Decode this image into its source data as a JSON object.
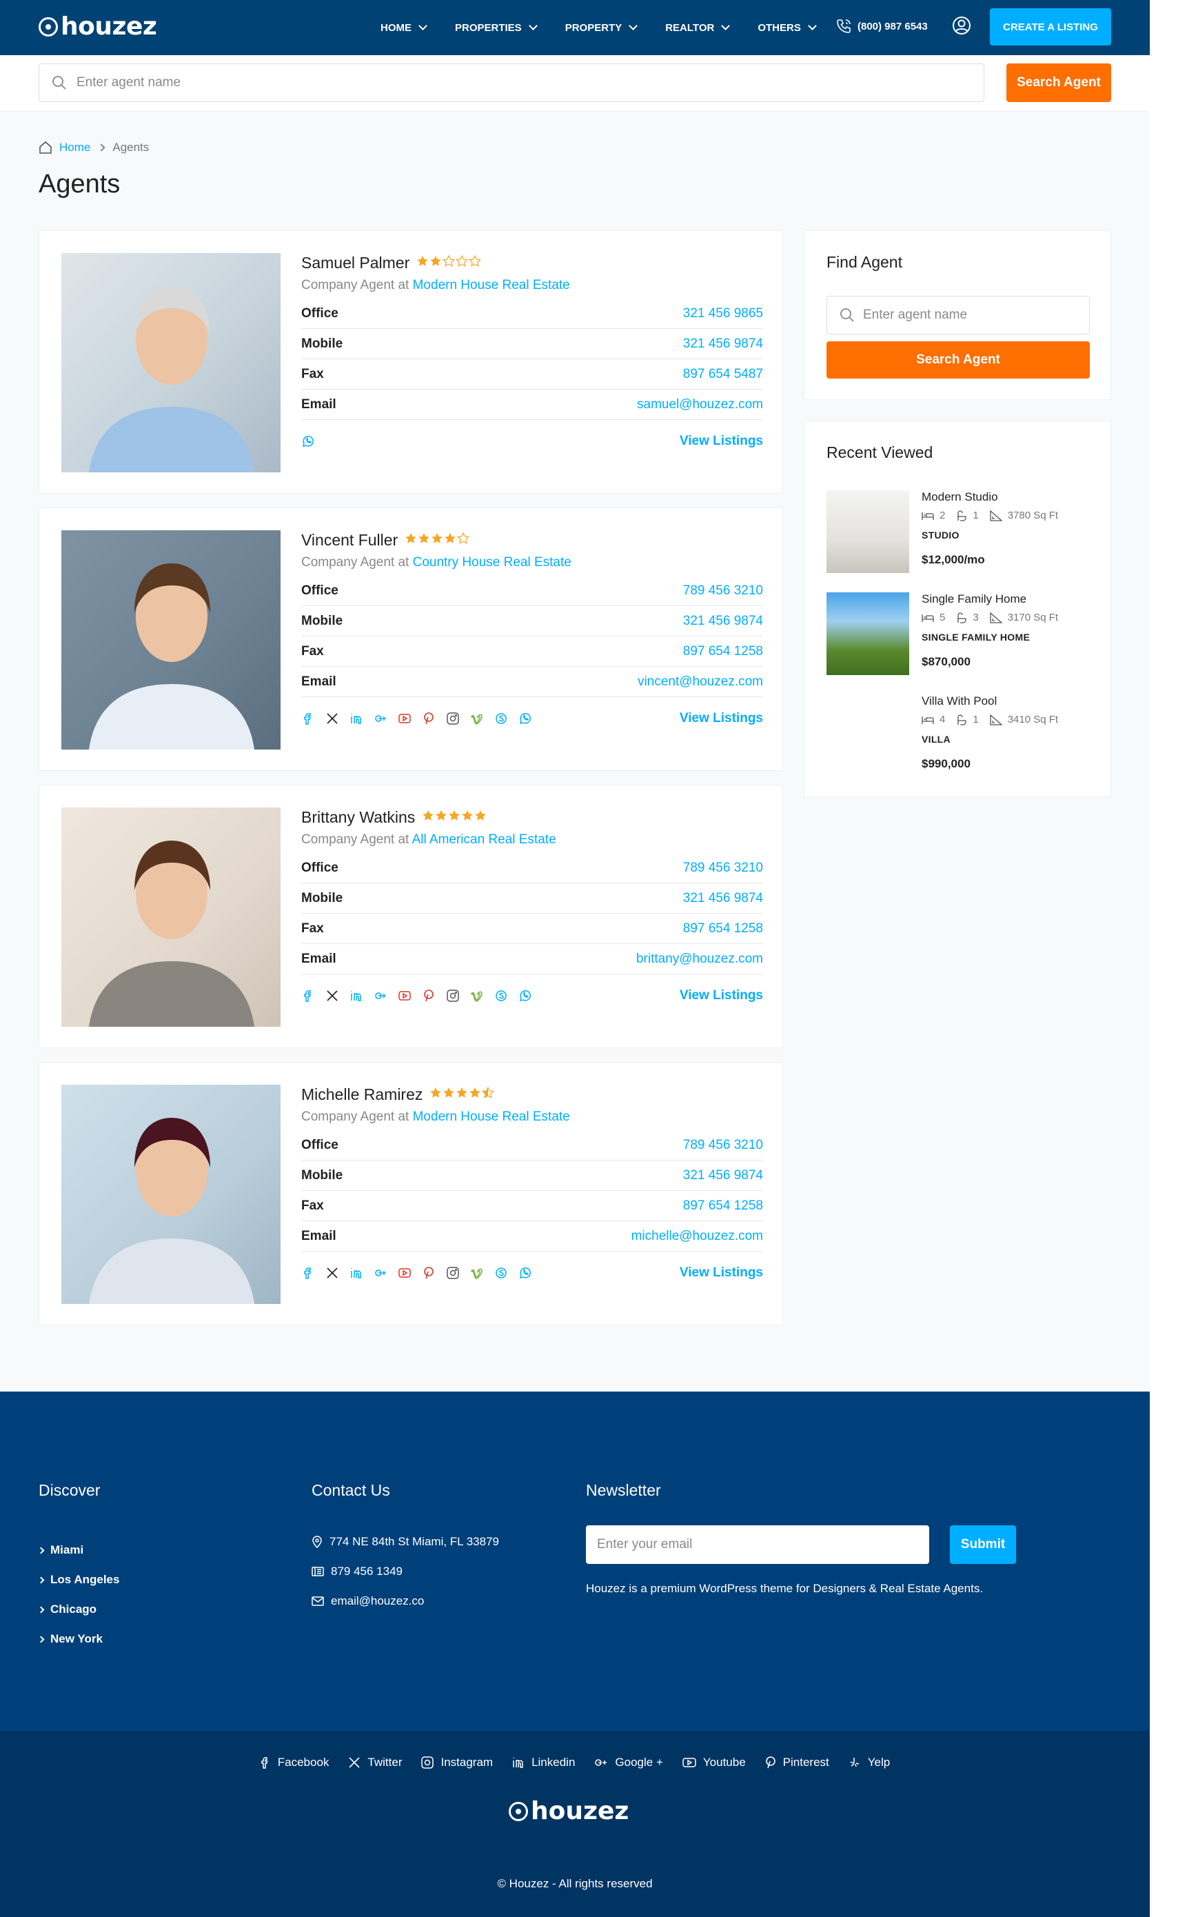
{
  "header": {
    "logo": "houzez",
    "nav": [
      "HOME",
      "PROPERTIES",
      "PROPERTY",
      "REALTOR",
      "OTHERS"
    ],
    "phone": "(800) 987 6543",
    "create_listing": "CREATE A LISTING"
  },
  "top_search": {
    "placeholder": "Enter agent name",
    "button": "Search Agent"
  },
  "breadcrumb": {
    "home": "Home",
    "current": "Agents"
  },
  "page_title": "Agents",
  "labels": {
    "office": "Office",
    "mobile": "Mobile",
    "fax": "Fax",
    "email": "Email",
    "company_prefix": "Company Agent at",
    "view_listings": "View Listings"
  },
  "agents": [
    {
      "name": "Samuel Palmer",
      "rating": 2,
      "company": "Modern House Real Estate",
      "office": "321 456 9865",
      "mobile": "321 456 9874",
      "fax": "897 654 5487",
      "email": "samuel@houzez.com",
      "social_icons": [
        "whatsapp-icon"
      ]
    },
    {
      "name": "Vincent Fuller",
      "rating": 4,
      "company": "Country House Real Estate",
      "office": "789 456 3210",
      "mobile": "321 456 9874",
      "fax": "897 654 1258",
      "email": "vincent@houzez.com",
      "social_icons": [
        "facebook-icon",
        "x-icon",
        "linkedin-icon",
        "google-plus-icon",
        "youtube-icon",
        "pinterest-icon",
        "instagram-icon",
        "vimeo-icon",
        "skype-icon",
        "whatsapp-icon"
      ]
    },
    {
      "name": "Brittany Watkins",
      "rating": 5,
      "company": "All American Real Estate",
      "office": "789 456 3210",
      "mobile": "321 456 9874",
      "fax": "897 654 1258",
      "email": "brittany@houzez.com",
      "social_icons": [
        "facebook-icon",
        "x-icon",
        "linkedin-icon",
        "google-plus-icon",
        "youtube-icon",
        "pinterest-icon",
        "instagram-icon",
        "vimeo-icon",
        "skype-icon",
        "whatsapp-icon"
      ]
    },
    {
      "name": "Michelle Ramirez",
      "rating": 4.5,
      "company": "Modern House Real Estate",
      "office": "789 456 3210",
      "mobile": "321 456 9874",
      "fax": "897 654 1258",
      "email": "michelle@houzez.com",
      "social_icons": [
        "facebook-icon",
        "x-icon",
        "linkedin-icon",
        "google-plus-icon",
        "youtube-icon",
        "pinterest-icon",
        "instagram-icon",
        "vimeo-icon",
        "skype-icon",
        "whatsapp-icon"
      ]
    }
  ],
  "sidebar": {
    "find_agent": {
      "title": "Find Agent",
      "placeholder": "Enter agent name",
      "button": "Search Agent"
    },
    "recent_viewed": {
      "title": "Recent Viewed",
      "items": [
        {
          "title": "Modern Studio",
          "beds": "2",
          "baths": "1",
          "area": "3780 Sq Ft",
          "type": "STUDIO",
          "price": "$12,000/mo"
        },
        {
          "title": "Single Family Home",
          "beds": "5",
          "baths": "3",
          "area": "3170 Sq Ft",
          "type": "SINGLE FAMILY HOME",
          "price": "$870,000"
        },
        {
          "title": "Villa With Pool",
          "beds": "4",
          "baths": "1",
          "area": "3410 Sq Ft",
          "type": "VILLA",
          "price": "$990,000"
        }
      ]
    }
  },
  "footer": {
    "discover": {
      "title": "Discover",
      "links": [
        "Miami",
        "Los Angeles",
        "Chicago",
        "New York"
      ]
    },
    "contact": {
      "title": "Contact Us",
      "address": "774 NE 84th St Miami, FL 33879",
      "phone": "879 456 1349",
      "email": "email@houzez.co"
    },
    "newsletter": {
      "title": "Newsletter",
      "placeholder": "Enter your email",
      "button": "Submit",
      "text": "Houzez is a premium WordPress theme for Designers & Real Estate Agents."
    },
    "social": [
      "Facebook",
      "Twitter",
      "Instagram",
      "Linkedin",
      "Google +",
      "Youtube",
      "Pinterest",
      "Yelp"
    ],
    "logo": "houzez",
    "copyright": "© Houzez - All rights reserved"
  },
  "colors": {
    "navy": "#004274",
    "accent_blue": "#00aeff",
    "orange": "#ff6e00",
    "star": "#f5a623"
  }
}
